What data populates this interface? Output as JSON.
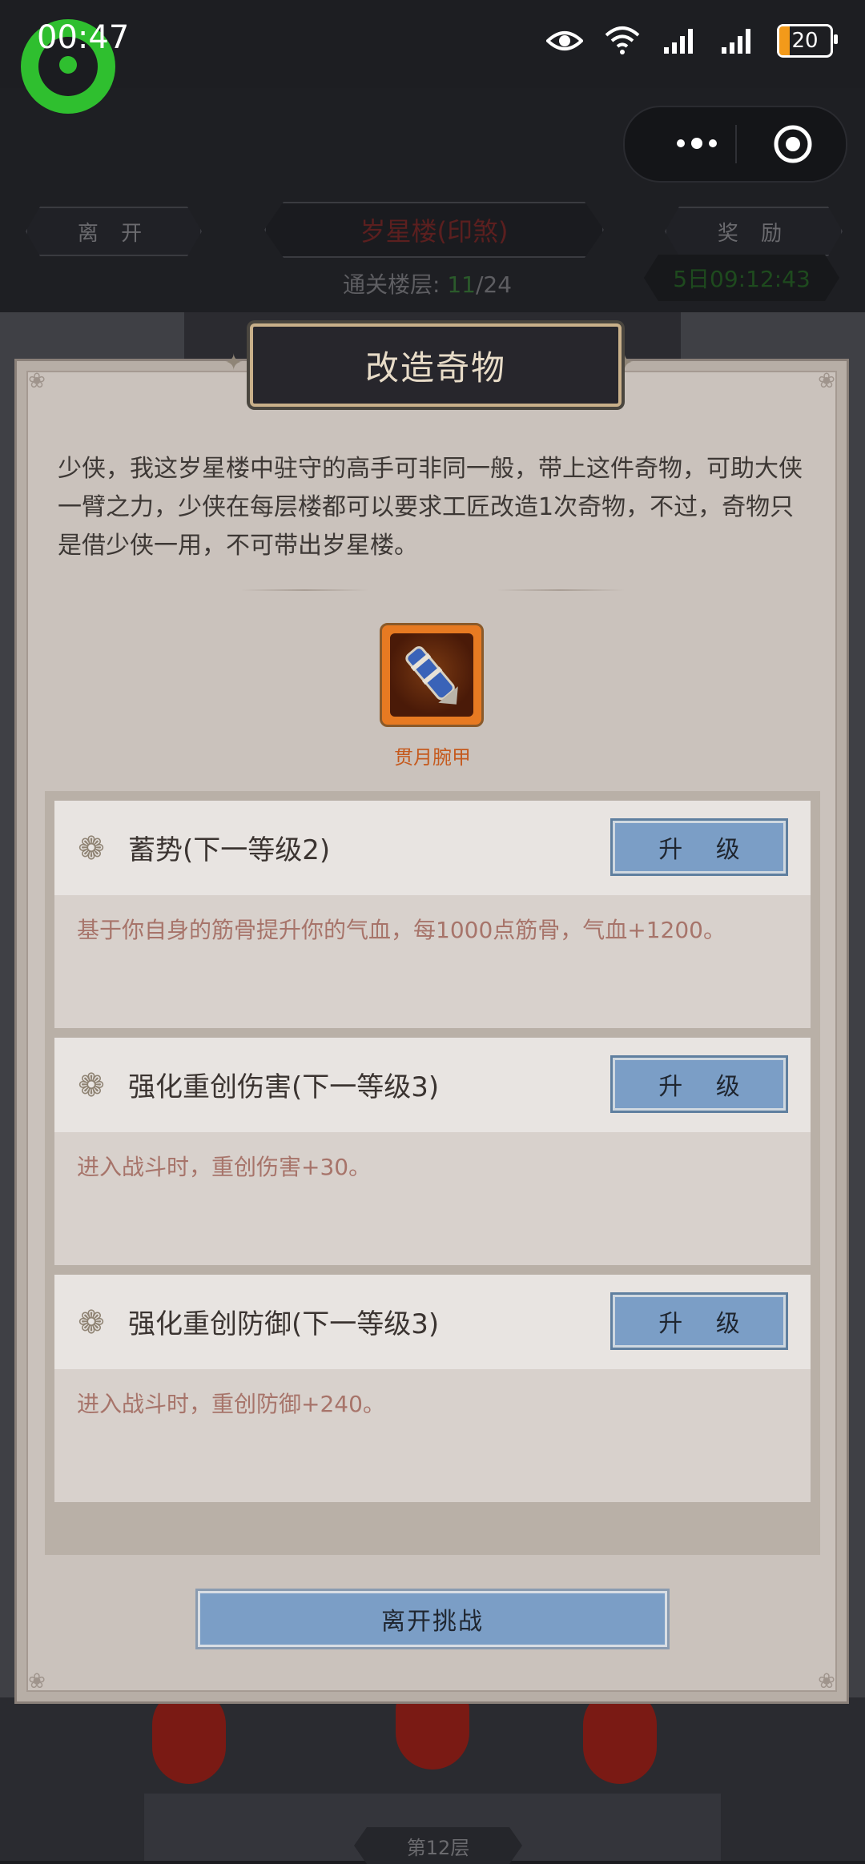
{
  "status_bar": {
    "time": "00:47",
    "battery": "20",
    "icons": [
      "eye-icon",
      "wifi-icon",
      "signal-icon",
      "signal-icon",
      "battery-icon"
    ]
  },
  "capsule": {
    "icons": [
      "more-icon",
      "target-icon"
    ]
  },
  "header": {
    "leave_label": "离 开",
    "floor_title": "岁星楼(印煞)",
    "reward_label": "奖 励",
    "cleared_label": "通关楼层:",
    "cleared_current": "11",
    "cleared_total": "/24",
    "timer": "5日09:12:43"
  },
  "dialog": {
    "title": "改造奇物",
    "intro": "少侠，我这岁星楼中驻守的高手可非同一般，带上这件奇物，可助大侠一臂之力，少侠在每层楼都可以要求工匠改造1次奇物，不过，奇物只是借少侠一用，不可带出岁星楼。",
    "item_name": "贯月腕甲",
    "upgrade_label": "升 级",
    "options": [
      {
        "title": "蓄势(下一等级2)",
        "desc": "基于你自身的筋骨提升你的气血，每1000点筋骨，气血+1200。"
      },
      {
        "title": "强化重创伤害(下一等级3)",
        "desc": "进入战斗时，重创伤害+30。"
      },
      {
        "title": "强化重创防御(下一等级3)",
        "desc": "进入战斗时，重创防御+240。"
      }
    ],
    "leave_button": "离开挑战"
  },
  "footer": {
    "floor_label": "第12层"
  },
  "colors": {
    "accent_button": "#7b9ec6",
    "item_orange": "#e77a22",
    "desc_text": "#a7746a"
  }
}
